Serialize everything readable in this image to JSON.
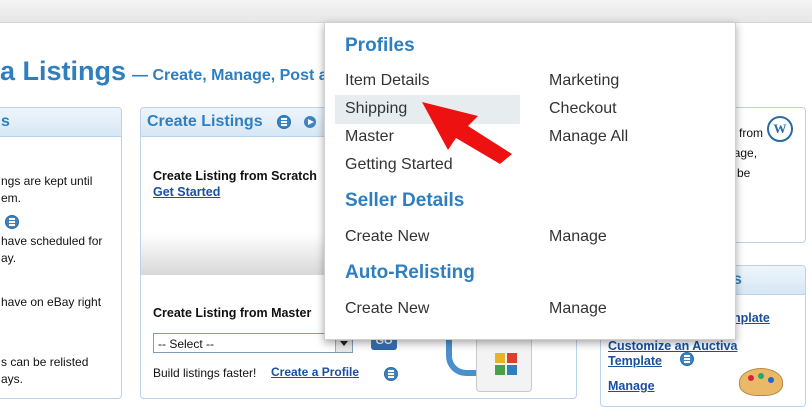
{
  "page": {
    "title_big": "a Listings",
    "title_sub": "— Create, Manage, Post ar"
  },
  "left_panel": {
    "head": "s",
    "lines": [
      "ngs are kept until",
      "em.",
      "have scheduled for",
      "ay.",
      "have on eBay right",
      "s can be relisted",
      "ays."
    ]
  },
  "create_panel": {
    "title": "Create Listings",
    "scratch_label": "Create Listing from Scratch",
    "get_started": "Get Started",
    "master_label": "Create Listing from Master",
    "select_value": "-- Select --",
    "go_label": "GO",
    "build_text": "Build listings faster!",
    "create_profile": "Create a Profile"
  },
  "right_panel": {
    "lines": [
      "from",
      "page,",
      "be"
    ],
    "head_partial": "s",
    "template_link": "nplate",
    "customize_line1": "Customize an Auctiva",
    "customize_line2": "Template",
    "manage_partial": "Manage"
  },
  "dropdown": {
    "profiles_heading": "Profiles",
    "profiles_col1": [
      "Item Details",
      "Shipping",
      "Master",
      "Getting Started"
    ],
    "profiles_col2": [
      "Marketing",
      "Checkout",
      "Manage All"
    ],
    "seller_heading": "Seller Details",
    "seller_col1": [
      "Create New"
    ],
    "seller_col2": [
      "Manage"
    ],
    "relist_heading": "Auto-Relisting",
    "relist_col1": [
      "Create New"
    ],
    "relist_col2": [
      "Manage"
    ],
    "highlighted_item": "Shipping"
  },
  "colors": {
    "accent": "#2f7fc0",
    "link": "#1a4fa0",
    "arrow": "#ee1111"
  }
}
